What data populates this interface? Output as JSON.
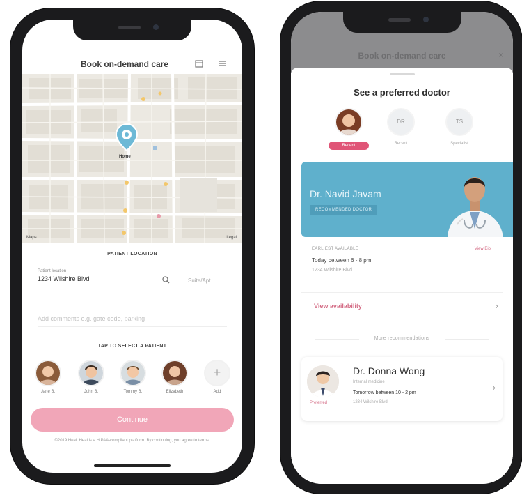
{
  "left_screen": {
    "header": {
      "title": "Book on-demand care",
      "icon_left": "calendar-icon",
      "icon_right": "menu-icon"
    },
    "map": {
      "pin_label": "Home",
      "attribution": "Maps",
      "legal": "Legal"
    },
    "patient_location": {
      "section_label": "PATIENT LOCATION",
      "address_caption": "Patient location",
      "address_value": "1234 Wilshire Blvd",
      "side_hint": "Suite/Apt",
      "comment_placeholder": "Add comments e.g. gate code, parking"
    },
    "patients": {
      "section_label": "TAP TO SELECT A PATIENT",
      "items": [
        {
          "name": "Jane B."
        },
        {
          "name": "John B."
        },
        {
          "name": "Tommy B."
        },
        {
          "name": "Elizabeth"
        },
        {
          "name": "Add"
        }
      ]
    },
    "continue_label": "Continue",
    "disclaimer": "©2019 Heal. Heal is a HIPAA-compliant platform. By continuing, you agree to terms."
  },
  "right_screen": {
    "dim_header": "Book on-demand care",
    "sheet_title": "See a preferred doctor",
    "chips": [
      {
        "label": "Recent",
        "initials": ""
      },
      {
        "label": "Recent",
        "initials": "DR"
      },
      {
        "label": "Specialist",
        "initials": "TS"
      }
    ],
    "featured": {
      "name": "Dr. Navid Javam",
      "tag": "RECOMMENDED DOCTOR",
      "availability_caption": "EARLIEST AVAILABLE",
      "availability_link": "View Bio",
      "time": "Today between 6 - 8 pm",
      "address": "1234 Wilshire Blvd",
      "view_label": "View availability"
    },
    "more_label": "More recommendations",
    "doctor_card": {
      "name": "Dr. Donna Wong",
      "badge": "Preferred",
      "specialty": "Internal medicine",
      "time": "Tomorrow between 10 - 2 pm",
      "address": "1234 Wilshire Blvd"
    }
  },
  "colors": {
    "brand_pink": "#e05577",
    "button_pink": "#f1a6b8",
    "banner_blue": "#5fb0cc"
  }
}
